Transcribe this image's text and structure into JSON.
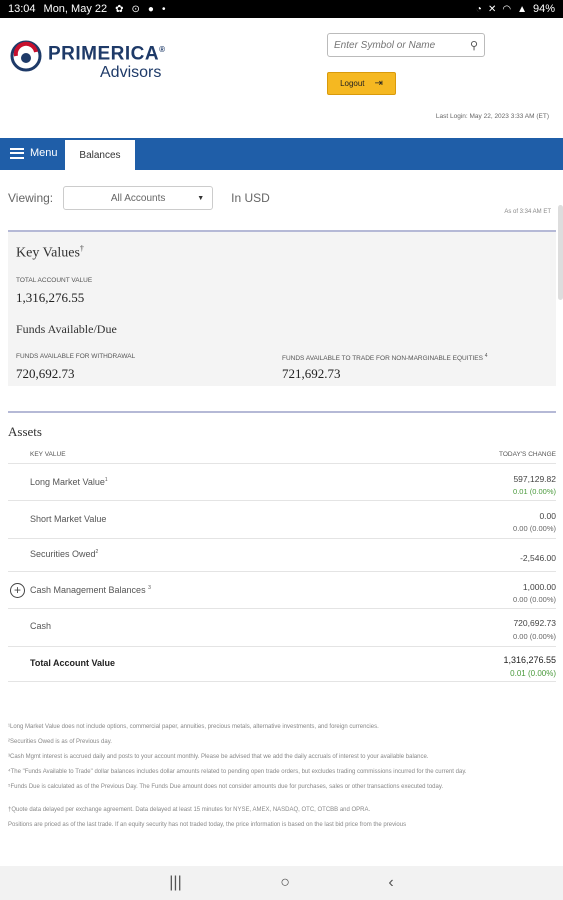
{
  "status": {
    "time": "13:04",
    "date": "Mon, May 22",
    "battery": "94%"
  },
  "brand": {
    "name": "PRIMERICA",
    "trademark": "®",
    "sub": "Advisors"
  },
  "search": {
    "placeholder": "Enter Symbol or Name"
  },
  "logout_label": "Logout",
  "last_login": "Last Login: May 22, 2023 3:33 AM (ET)",
  "nav": {
    "menu_label": "Menu",
    "tab_label": "Balances"
  },
  "viewing": {
    "label": "Viewing:",
    "selected": "All Accounts",
    "currency": "In USD",
    "as_of": "As of 3:34 AM ET"
  },
  "key_values": {
    "title": "Key Values",
    "title_mark": "†",
    "total_label": "TOTAL ACCOUNT VALUE",
    "total_value": "1,316,276.55",
    "funds_title": "Funds Available/Due",
    "withdrawal_label": "FUNDS AVAILABLE FOR WITHDRAWAL",
    "withdrawal_value": "720,692.73",
    "trade_label": "FUNDS AVAILABLE TO TRADE FOR NON-MARGINABLE EQUITIES",
    "trade_mark": "4",
    "trade_value": "721,692.73"
  },
  "assets": {
    "title": "Assets",
    "col_key": "KEY VALUE",
    "col_change": "TODAY'S CHANGE",
    "rows": [
      {
        "label": "Long Market Value",
        "mark": "1",
        "value": "597,129.82",
        "change": "0.01",
        "pct": "(0.00%)"
      },
      {
        "label": "Short Market Value",
        "mark": "",
        "value": "0.00",
        "change": "0.00",
        "pct": "(0.00%)"
      },
      {
        "label": "Securities Owed",
        "mark": "2",
        "value": "-2,546.00",
        "change": "",
        "pct": ""
      },
      {
        "label": "Cash Management Balances",
        "mark": "3",
        "value": "1,000.00",
        "change": "0.00",
        "pct": "(0.00%)"
      },
      {
        "label": "Cash",
        "mark": "",
        "value": "720,692.73",
        "change": "0.00",
        "pct": "(0.00%)"
      },
      {
        "label": "Total Account Value",
        "mark": "",
        "value": "1,316,276.55",
        "change": "0.01",
        "pct": "(0.00%)"
      }
    ]
  },
  "footnotes": [
    "¹Long Market Value does not include options, commercial paper, annuities, precious metals, alternative investments, and foreign currencies.",
    "²Securities Owed is as of Previous day.",
    "³Cash Mgmt interest is accrued daily and posts to your account monthly. Please be advised that we add the daily accruals of interest to your available balance.",
    "⁴The \"Funds Available to Trade\" dollar balances includes dollar amounts related to pending open trade orders, but excludes trading commissions incurred for the current day.",
    "⁵Funds Due is calculated as of the Previous Day. The Funds Due amount does not consider amounts due for purchases, sales or other transactions executed today.",
    "",
    "†Quote data delayed per exchange agreement. Data delayed at least 15 minutes for NYSE, AMEX, NASDAQ, OTC, OTCBB and OPRA.",
    "Positions are priced as of the last trade. If an equity security has not traded today, the price information is based on the last bid price from the previous"
  ]
}
